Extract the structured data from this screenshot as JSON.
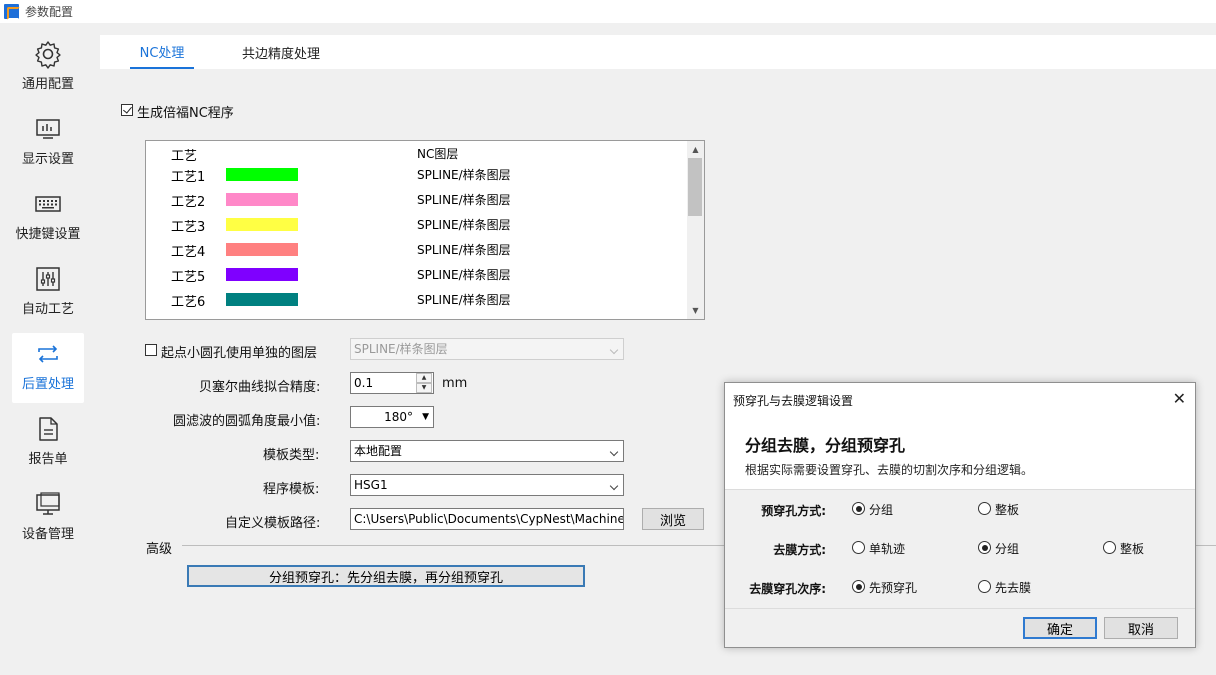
{
  "window": {
    "title": "参数配置"
  },
  "sidebar": {
    "items": [
      {
        "label": "通用配置",
        "icon": "gear-icon"
      },
      {
        "label": "显示设置",
        "icon": "monitor-chart-icon"
      },
      {
        "label": "快捷键设置",
        "icon": "keyboard-icon"
      },
      {
        "label": "自动工艺",
        "icon": "sliders-icon"
      },
      {
        "label": "后置处理",
        "icon": "repeat-arrows-icon",
        "active": true
      },
      {
        "label": "报告单",
        "icon": "document-icon"
      },
      {
        "label": "设备管理",
        "icon": "desktop-icon"
      }
    ]
  },
  "tabs": [
    {
      "label": "NC处理",
      "active": true
    },
    {
      "label": "共边精度处理"
    }
  ],
  "nc": {
    "multi_nc_label": "生成倍福NC程序",
    "multi_nc_checked": true,
    "process_list": {
      "header": {
        "name": "工艺",
        "layer": "NC图层"
      },
      "rows": [
        {
          "name": "工艺1",
          "color": "#00ff00",
          "layer": "SPLINE/样条图层"
        },
        {
          "name": "工艺2",
          "color": "#ff88c8",
          "layer": "SPLINE/样条图层"
        },
        {
          "name": "工艺3",
          "color": "#ffff44",
          "layer": "SPLINE/样条图层"
        },
        {
          "name": "工艺4",
          "color": "#ff8080",
          "layer": "SPLINE/样条图层"
        },
        {
          "name": "工艺5",
          "color": "#7f00ff",
          "layer": "SPLINE/样条图层"
        },
        {
          "name": "工艺6",
          "color": "#008080",
          "layer": "SPLINE/样条图层"
        }
      ]
    },
    "small_hole_label": "起点小圆孔使用单独的图层",
    "small_hole_checked": false,
    "small_hole_layer": "SPLINE/样条图层",
    "bezier_label": "贝塞尔曲线拟合精度:",
    "bezier_value": "0.1",
    "bezier_unit": "mm",
    "arc_label": "圆滤波的圆弧角度最小值:",
    "arc_value": "180°",
    "template_type_label": "模板类型:",
    "template_type_value": "本地配置",
    "program_template_label": "程序模板:",
    "program_template_value": "HSG1",
    "custom_path_label": "自定义模板路径:",
    "custom_path_value": "C:\\Users\\Public\\Documents\\CypNest\\Machine",
    "browse_label": "浏览",
    "advanced_label": "高级",
    "group_button_label": "分组预穿孔：先分组去膜，再分组预穿孔"
  },
  "dialog": {
    "title": "预穿孔与去膜逻辑设置",
    "heading": "分组去膜，分组预穿孔",
    "subtitle": "根据实际需要设置穿孔、去膜的切割次序和分组逻辑。",
    "pierce_label": "预穿孔方式:",
    "pierce_options": [
      "分组",
      "整板"
    ],
    "pierce_selected": 0,
    "film_label": "去膜方式:",
    "film_options": [
      "单轨迹",
      "分组",
      "整板"
    ],
    "film_selected": 1,
    "order_label": "去膜穿孔次序:",
    "order_options": [
      "先预穿孔",
      "先去膜"
    ],
    "order_selected": 0,
    "ok_label": "确定",
    "cancel_label": "取消"
  }
}
